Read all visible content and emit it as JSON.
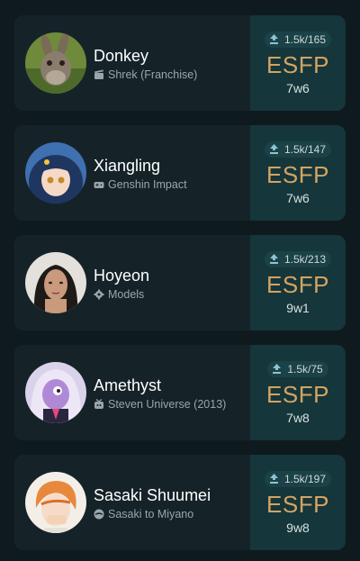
{
  "profiles": [
    {
      "name": "Donkey",
      "source": "Shrek (Franchise)",
      "source_icon": "movie-icon",
      "stats": "1.5k/165",
      "type": "ESFP",
      "wing": "7w6"
    },
    {
      "name": "Xiangling",
      "source": "Genshin Impact",
      "source_icon": "gamepad-icon",
      "stats": "1.5k/147",
      "type": "ESFP",
      "wing": "7w6"
    },
    {
      "name": "Hoyeon",
      "source": "Models",
      "source_icon": "gear-icon",
      "stats": "1.5k/213",
      "type": "ESFP",
      "wing": "9w1"
    },
    {
      "name": "Amethyst",
      "source": "Steven Universe (2013)",
      "source_icon": "tv-icon",
      "stats": "1.5k/75",
      "type": "ESFP",
      "wing": "7w8"
    },
    {
      "name": "Sasaki Shuumei",
      "source": "Sasaki to Miyano",
      "source_icon": "anime-icon",
      "stats": "1.5k/197",
      "type": "ESFP",
      "wing": "9w8"
    }
  ],
  "colors": {
    "type_text": "#d3a462",
    "card_bg": "#152329",
    "type_panel_bg": "#15363a"
  }
}
